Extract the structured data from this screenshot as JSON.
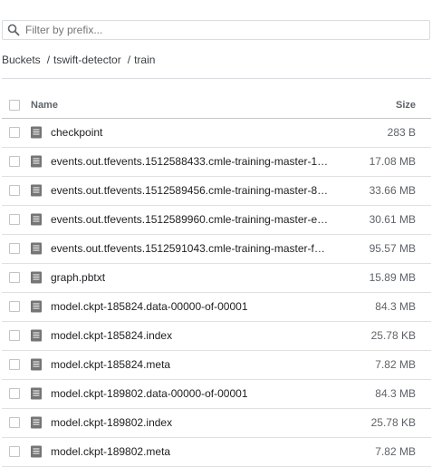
{
  "filter": {
    "placeholder": "Filter by prefix..."
  },
  "breadcrumb": [
    "Buckets",
    "tswift-detector",
    "train"
  ],
  "breadcrumb_separator": "/",
  "table": {
    "headers": {
      "name": "Name",
      "size": "Size"
    },
    "rows": [
      {
        "name": "checkpoint",
        "size": "283 B"
      },
      {
        "name": "events.out.tfevents.1512588433.cmle-training-master-1…",
        "size": "17.08 MB"
      },
      {
        "name": "events.out.tfevents.1512589456.cmle-training-master-8…",
        "size": "33.66 MB"
      },
      {
        "name": "events.out.tfevents.1512589960.cmle-training-master-e…",
        "size": "30.61 MB"
      },
      {
        "name": "events.out.tfevents.1512591043.cmle-training-master-f…",
        "size": "95.57 MB"
      },
      {
        "name": "graph.pbtxt",
        "size": "15.89 MB"
      },
      {
        "name": "model.ckpt-185824.data-00000-of-00001",
        "size": "84.3 MB"
      },
      {
        "name": "model.ckpt-185824.index",
        "size": "25.78 KB"
      },
      {
        "name": "model.ckpt-185824.meta",
        "size": "7.82 MB"
      },
      {
        "name": "model.ckpt-189802.data-00000-of-00001",
        "size": "84.3 MB"
      },
      {
        "name": "model.ckpt-189802.index",
        "size": "25.78 KB"
      },
      {
        "name": "model.ckpt-189802.meta",
        "size": "7.82 MB"
      }
    ]
  },
  "icons": {
    "search": "search-icon",
    "file": "file-icon"
  },
  "colors": {
    "text": "#202124",
    "muted": "#5f6368",
    "icon": "#757575",
    "divider": "#e0e0e0"
  }
}
